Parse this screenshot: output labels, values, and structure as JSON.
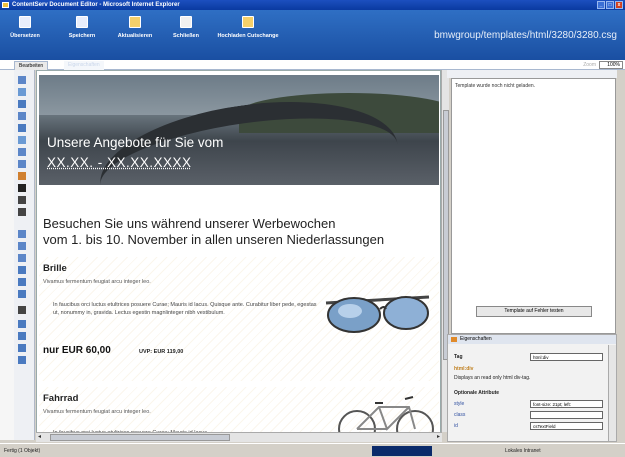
{
  "window": {
    "title": "ContentServ Document Editor - Microsoft Internet Explorer",
    "buttons": [
      "_",
      "□",
      "x"
    ]
  },
  "toolbar": {
    "items": [
      {
        "label": "Übersetzen",
        "icon": "save-icon"
      },
      {
        "label": "Speichern",
        "icon": "disk-icon"
      },
      {
        "label": "Aktualisieren",
        "icon": "refresh-icon"
      },
      {
        "label": "Schließen",
        "icon": "close-icon"
      },
      {
        "label": "Hochladen Cutschange",
        "icon": "upload-icon"
      }
    ],
    "path": "bmwgroup/templates/html/3280/3280.csg"
  },
  "tabs": {
    "active": "Bearbeiten",
    "inactive": "Eigenschaften",
    "zoom_label": "Zoom",
    "zoom_value": "100%"
  },
  "editor": {
    "hero_title": "Unsere Angebote für Sie vom",
    "hero_date": "XX.XX. - XX.XX.XXXX",
    "headline_line1": "Besuchen Sie uns während unserer Werbewochen",
    "headline_line2": "vom 1. bis 10. November in allen unseren Niederlassungen",
    "products": [
      {
        "name": "Brille",
        "tagline": "Vivamus fermentum feugiat arcu integer leo.",
        "description": "In faucibus orci luctus etultrices posuere Curae; Mauris id lacus. Quisque ante. Curabitur liber pede, egestas ut, nonummy in, gravida. Lectus egestin magnlinteger nibh vestibulum.",
        "price": "nur EUR 60,00",
        "uvp": "UVP: EUR 119,00"
      },
      {
        "name": "Fahrrad",
        "tagline": "Vivamus fermentum feugiat arcu integer leo.",
        "description": "In faucibus orci luctus etultrices posuere Curae; Mauris id lacus."
      }
    ]
  },
  "rightpanel": {
    "message": "Template wurde noch nicht geladen.",
    "test_button": "Template auf Fehler testen"
  },
  "properties": {
    "header": "Eigenschaften",
    "tag_label": "Tag",
    "tag_value": "html:div",
    "element_name": "html:div",
    "element_desc": "Displays an read only html div-tag.",
    "optional_label": "Optionale Attribute",
    "style_label": "style",
    "style_value": "font-size: 21pt; left: ",
    "class_label": "class",
    "class_value": "",
    "id_label": "id",
    "id_value": "csTextField"
  },
  "statusbar": {
    "left": "Fertig (1 Objekt)",
    "right": "Lokales Intranet"
  },
  "colors": {
    "toolbar": "#1a4fa2",
    "title": "#0a3aa0"
  }
}
